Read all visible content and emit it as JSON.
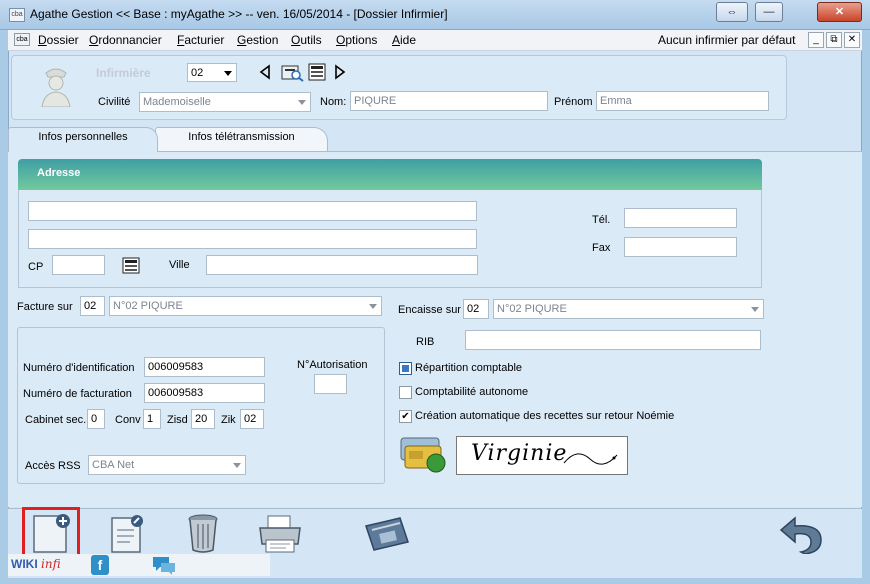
{
  "window": {
    "title": "Agathe Gestion << Base : myAgathe >>   --   ven. 16/05/2014  - [Dossier Infirmier]",
    "app_icon_text": "cba",
    "controls": {
      "restore": "⇔",
      "minimize": "—",
      "close": "✕"
    }
  },
  "menu": {
    "items": [
      {
        "key": "D",
        "rest": "ossier"
      },
      {
        "key": "O",
        "rest": "rdonnancier"
      },
      {
        "key": "F",
        "rest": "acturier"
      },
      {
        "key": "G",
        "rest": "estion"
      },
      {
        "key": "O",
        "rest": "utils",
        "prefix": ""
      },
      {
        "key": "O",
        "rest": "ptions"
      },
      {
        "key": "A",
        "rest": "ide"
      }
    ],
    "right_status": "Aucun infirmier par défaut",
    "mdi_controls": {
      "minimize": "_",
      "restore": "⧉",
      "close": "✕"
    }
  },
  "header": {
    "role_label": "Infirmière",
    "number": "02",
    "civility_label": "Civilité",
    "civility_value": "Mademoiselle",
    "nom_label": "Nom:",
    "nom_value": "PIQURE",
    "prenom_label": "Prénom",
    "prenom_value": "Emma"
  },
  "tabs": [
    {
      "label": "Infos personnelles",
      "active": true
    },
    {
      "label": "Infos télétransmission",
      "active": false
    }
  ],
  "address": {
    "title": "Adresse",
    "line1": "",
    "line2": "",
    "cp_label": "CP",
    "cp_value": "",
    "ville_label": "Ville",
    "ville_value": "",
    "tel_label": "Tél.",
    "tel_value": "",
    "fax_label": "Fax",
    "fax_value": ""
  },
  "billing": {
    "facture_label": "Facture sur",
    "facture_num": "02",
    "facture_value": "N°02  PIQURE",
    "encaisse_label": "Encaisse sur",
    "encaisse_num": "02",
    "encaisse_value": "N°02  PIQURE",
    "rib_label": "RIB",
    "rib_value": ""
  },
  "identification": {
    "num_id_label": "Numéro d'identification",
    "num_id_value": "006009583",
    "num_fact_label": "Numéro de facturation",
    "num_fact_value": "006009583",
    "autorisation_label": "N°Autorisation",
    "autorisation_value": "",
    "cabinet_label": "Cabinet sec.",
    "cabinet_value": "0",
    "conv_label": "Conv",
    "conv_value": "1",
    "zisd_label": "Zisd",
    "zisd_value": "20",
    "zik_label": "Zik",
    "zik_value": "02",
    "rss_label": "Accès RSS",
    "rss_value": "CBA Net"
  },
  "options": [
    {
      "label": "Répartition comptable",
      "checked": "filled"
    },
    {
      "label": "Comptabilité autonome",
      "checked": "none"
    },
    {
      "label": "Création automatique des recettes sur retour Noémie",
      "checked": "tick"
    }
  ],
  "signature": {
    "text": "Virginie"
  },
  "footer": {
    "wiki_text": "WIKI",
    "wiki_suffix": "infi",
    "facebook_letter": "f"
  },
  "colors": {
    "accent_red": "#e0201c",
    "header_gradient_start": "#3f9fa4",
    "header_gradient_end": "#72c99d",
    "background": "#a9cbe6"
  }
}
